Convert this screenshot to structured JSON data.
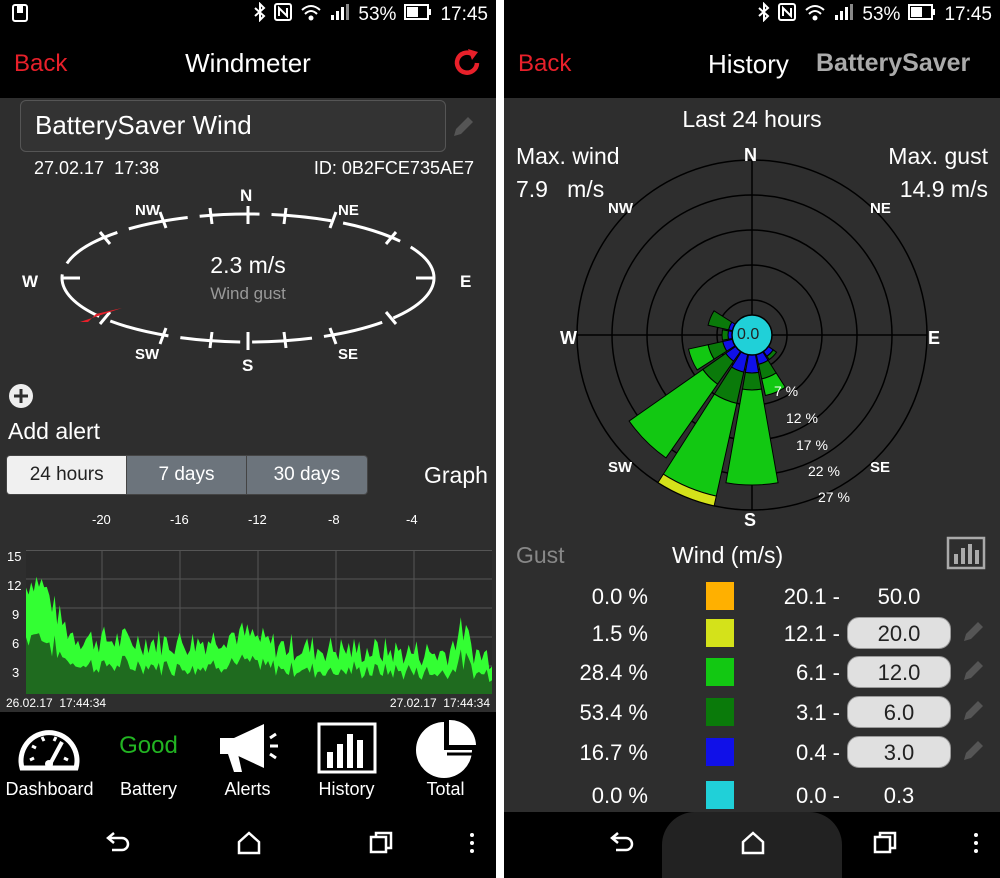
{
  "status": {
    "battery_pct": "53%",
    "time": "17:45"
  },
  "left": {
    "appbar": {
      "back": "Back",
      "title": "Windmeter"
    },
    "device": {
      "name": "BatterySaver Wind",
      "date": "27.02.17  17:38",
      "id": "ID: 0B2FCE735AE7"
    },
    "compass": {
      "n": "N",
      "ne": "NE",
      "e": "E",
      "se": "SE",
      "s": "S",
      "sw": "SW",
      "w": "W",
      "nw": "NW",
      "speed": "2.3 m/s",
      "caption": "Wind gust",
      "needle_direction_deg": 245
    },
    "add_alert": "Add alert",
    "segments": [
      "24 hours",
      "7 days",
      "30 days"
    ],
    "selected_segment": "24 hours",
    "graph_label": "Graph",
    "graph_x_ticks": [
      "-20",
      "-16",
      "-12",
      "-8",
      "-4"
    ],
    "graph_y_ticks": [
      "15",
      "12",
      "9",
      "6",
      "3"
    ],
    "graph_start": "26.02.17  17:44:34",
    "graph_end": "27.02.17  17:44:34",
    "bottomnav": {
      "dashboard": "Dashboard",
      "battery_status": "Good",
      "battery": "Battery",
      "alerts": "Alerts",
      "history": "History",
      "total": "Total"
    }
  },
  "right": {
    "appbar": {
      "back": "Back",
      "title": "History",
      "brand": "BatterySaver"
    },
    "period": "Last 24 hours",
    "max_wind_label": "Max. wind",
    "max_wind_value": "7.9   m/s",
    "max_gust_label": "Max. gust",
    "max_gust_value": "14.9 m/s",
    "rose": {
      "n": "N",
      "ne": "NE",
      "e": "E",
      "se": "SE",
      "s": "S",
      "sw": "SW",
      "w": "W",
      "nw": "NW",
      "center": "0.0",
      "ring_labels": [
        "7 %",
        "12 %",
        "17 %",
        "22 %",
        "27 %"
      ]
    },
    "legend_tab_gust": "Gust",
    "legend_title": "Wind (m/s)",
    "legend_rows": [
      {
        "pct": "0.0 %",
        "color": "#ffb000",
        "low": "20.1 -",
        "high": "50.0",
        "editable": false
      },
      {
        "pct": "1.5 %",
        "color": "#d4e21a",
        "low": "12.1 -",
        "high": "20.0",
        "editable": true
      },
      {
        "pct": "28.4 %",
        "color": "#12c812",
        "low": "6.1 -",
        "high": "12.0",
        "editable": true
      },
      {
        "pct": "53.4 %",
        "color": "#0a7a0a",
        "low": "3.1 -",
        "high": "6.0",
        "editable": true
      },
      {
        "pct": "16.7 %",
        "color": "#1010e8",
        "low": "0.4 -",
        "high": "3.0",
        "editable": true
      },
      {
        "pct": "0.0 %",
        "color": "#20d0d8",
        "low": "0.0 -",
        "high": "0.3",
        "editable": false
      }
    ]
  },
  "colors": {
    "accent_red": "#e8202a",
    "battery_good": "#22b422",
    "graph_green": "#33ff33",
    "graph_dark": "#1f6b1f"
  }
}
